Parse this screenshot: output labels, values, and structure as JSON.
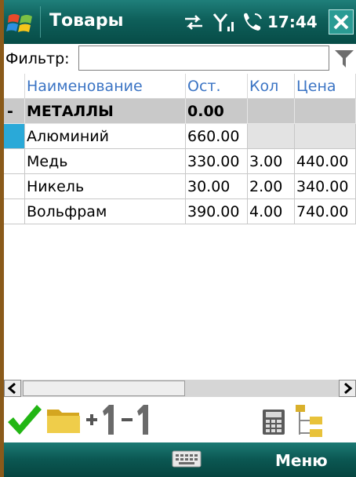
{
  "titlebar": {
    "title": "Товары",
    "time": "17:44",
    "icons": [
      "windows-start-icon",
      "sync-arrows-icon",
      "signal-strength-icon",
      "phone-call-icon",
      "close-icon"
    ]
  },
  "filter": {
    "label": "Фильтр:",
    "value": "",
    "icon": "funnel-filter-icon"
  },
  "grid": {
    "columns": [
      "",
      "Наименование",
      "Ост.",
      "Кол",
      "Цена"
    ],
    "group": {
      "toggle": "-",
      "name": "МЕТАЛЛЫ",
      "rest": "0.00"
    },
    "rows": [
      {
        "name": "Алюминий",
        "rest": "660.00",
        "qty": "",
        "price": ""
      },
      {
        "name": "Медь",
        "rest": "330.00",
        "qty": "3.00",
        "price": "440.00"
      },
      {
        "name": "Никель",
        "rest": "30.00",
        "qty": "2.00",
        "price": "340.00"
      },
      {
        "name": "Вольфрам",
        "rest": "390.00",
        "qty": "4.00",
        "price": "740.00"
      }
    ],
    "selected_row_index": 0
  },
  "scrollbar": {
    "left_icon": "scroll-left-icon",
    "right_icon": "scroll-right-icon"
  },
  "toolbar": {
    "icons": [
      "checkmark-icon",
      "folder-icon",
      "plus-one-icon",
      "minus-one-icon",
      "calculator-icon",
      "tree-structure-icon"
    ],
    "plus_one": "+1",
    "minus_one": "−1"
  },
  "softkeys": {
    "left_icon": "keyboard-icon",
    "right_label": "Меню"
  },
  "colors": {
    "titlebar": "#0e5f5a",
    "header_text": "#3b74c4",
    "group_bg": "#c9c9c9",
    "selection": "#2aa9d8",
    "check": "#22b614",
    "folder": "#e8c23a"
  }
}
